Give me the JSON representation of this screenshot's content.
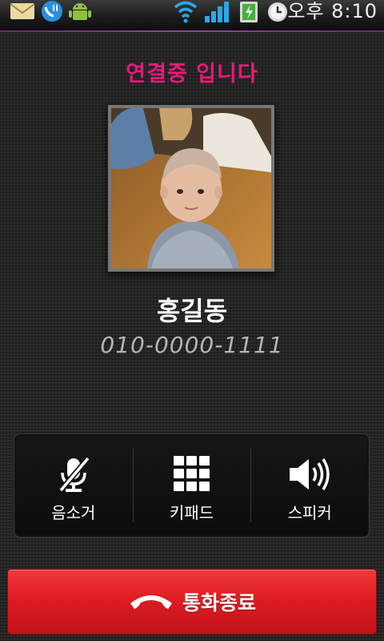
{
  "status_bar": {
    "time": "오후 8:10",
    "icons": [
      "email-icon",
      "vvm-icon",
      "android-icon",
      "wifi-icon",
      "signal-icon",
      "battery-icon",
      "alarm-icon"
    ]
  },
  "call": {
    "status_text": "연결중 입니다",
    "contact_name": "홍길동",
    "contact_number": "010-0000-1111"
  },
  "controls": [
    {
      "label": "음소거",
      "icon": "mute-icon"
    },
    {
      "label": "키패드",
      "icon": "keypad-icon"
    },
    {
      "label": "스피커",
      "icon": "speaker-icon"
    }
  ],
  "end_call": {
    "label": "통화종료",
    "icon": "phone-hangup-icon"
  },
  "colors": {
    "status_accent": "#e8197a",
    "end_call_red": "#de1d22"
  }
}
